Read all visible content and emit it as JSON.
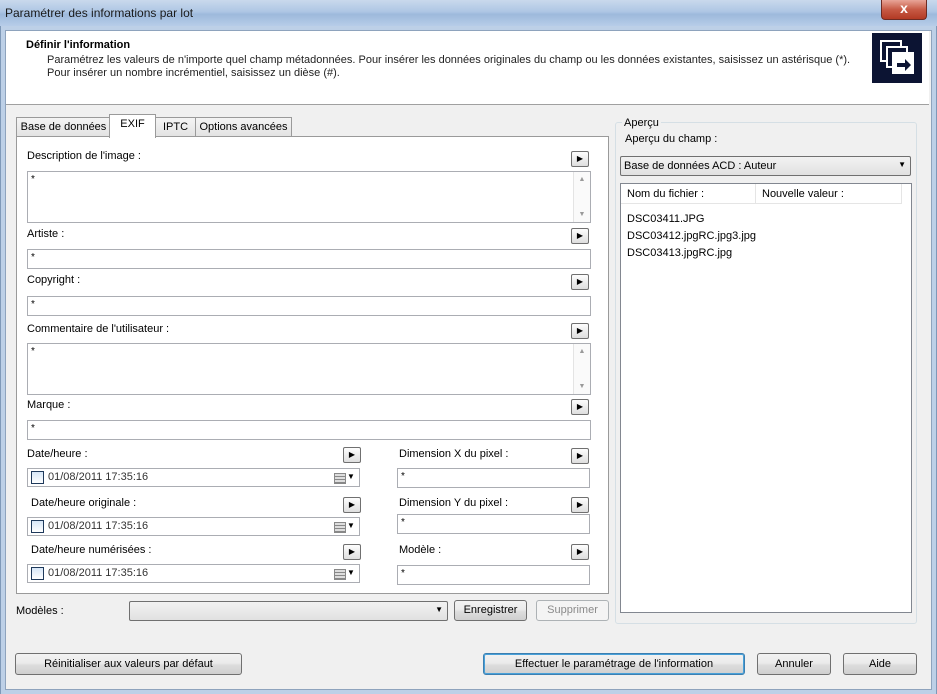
{
  "window": {
    "title": "Paramétrer des informations par lot",
    "close_label": "x"
  },
  "header": {
    "title": "Définir l'information",
    "description": "Paramétrez les valeurs de n'importe quel champ métadonnées. Pour insérer les données originales du champ ou les données existantes, saisissez un astérisque (*). Pour insérer un nombre incrémentiel, saisissez un dièse (#)."
  },
  "tabs": [
    {
      "label": "Base de données"
    },
    {
      "label": "EXIF"
    },
    {
      "label": "IPTC"
    },
    {
      "label": "Options avancées"
    }
  ],
  "arrow_glyph": "▶",
  "fields": {
    "description": {
      "label": "Description de l'image :",
      "value": "*"
    },
    "artiste": {
      "label": "Artiste :",
      "value": "*"
    },
    "copyright": {
      "label": "Copyright :",
      "value": "*"
    },
    "commentaire": {
      "label": "Commentaire de l'utilisateur :",
      "value": "*"
    },
    "marque": {
      "label": "Marque :",
      "value": "*"
    },
    "date_heure": {
      "label": "Date/heure :",
      "value": "01/08/2011 17:35:16"
    },
    "date_originale": {
      "label": "Date/heure originale :",
      "value": "01/08/2011 17:35:16"
    },
    "date_numerisee": {
      "label": "Date/heure numérisées :",
      "value": "01/08/2011 17:35:16"
    },
    "dim_x": {
      "label": "Dimension X du pixel :",
      "value": "*"
    },
    "dim_y": {
      "label": "Dimension Y du pixel :",
      "value": "*"
    },
    "modele": {
      "label": "Modèle :",
      "value": "*"
    }
  },
  "templates": {
    "label": "Modèles :",
    "selected": "",
    "save_label": "Enregistrer",
    "delete_label": "Supprimer"
  },
  "preview": {
    "group_title": "Aperçu",
    "field_label": "Aperçu du champ :",
    "selected_field": "Base de données ACD : Auteur",
    "columns": [
      "Nom du fichier :",
      "Nouvelle valeur :"
    ],
    "rows": [
      {
        "file": "DSC03411.JPG",
        "value": ""
      },
      {
        "file": "DSC03412.jpgRC.jpg3.jpg",
        "value": ""
      },
      {
        "file": "DSC03413.jpgRC.jpg",
        "value": ""
      }
    ]
  },
  "footer": {
    "reset_label": "Réinitialiser aux valeurs par défaut",
    "apply_label": "Effectuer le paramétrage de l'information",
    "cancel_label": "Annuler",
    "help_label": "Aide"
  }
}
